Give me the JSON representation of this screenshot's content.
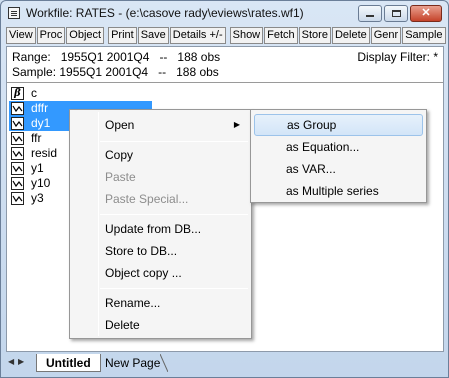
{
  "window": {
    "title": "Workfile: RATES - (e:\\casove rady\\eviews\\rates.wf1)",
    "controls": {
      "close_label": "✕"
    }
  },
  "toolbar": {
    "buttons": [
      "View",
      "Proc",
      "Object",
      "Print",
      "Save",
      "Details +/-",
      "Show",
      "Fetch",
      "Store",
      "Delete",
      "Genr",
      "Sample"
    ]
  },
  "info": {
    "range_line": "Range:   1955Q1 2001Q4   --   188 obs",
    "sample_line": "Sample: 1955Q1 2001Q4   --   188 obs",
    "display_filter": "Display Filter: *"
  },
  "objects": [
    {
      "name": "c",
      "icon": "coef-beta-icon",
      "glyph": "β",
      "selected": false
    },
    {
      "name": "dffr",
      "icon": "series-icon",
      "selected": true
    },
    {
      "name": "dy1",
      "icon": "series-icon",
      "selected": true
    },
    {
      "name": "ffr",
      "icon": "series-icon",
      "selected": false
    },
    {
      "name": "resid",
      "icon": "series-icon",
      "selected": false
    },
    {
      "name": "y1",
      "icon": "series-icon",
      "selected": false
    },
    {
      "name": "y10",
      "icon": "series-icon",
      "selected": false
    },
    {
      "name": "y3",
      "icon": "series-icon",
      "selected": false
    }
  ],
  "context_menu": {
    "items": [
      {
        "label": "Open",
        "has_submenu": true,
        "highlighted": false,
        "disabled": false
      },
      {
        "label": "Copy",
        "disabled": false
      },
      {
        "label": "Paste",
        "disabled": true
      },
      {
        "label": "Paste Special...",
        "disabled": true
      },
      {
        "label": "Update from DB...",
        "disabled": false
      },
      {
        "label": "Store to DB...",
        "disabled": false
      },
      {
        "label": "Object copy ...",
        "disabled": false
      },
      {
        "label": "Rename...",
        "disabled": false
      },
      {
        "label": "Delete",
        "disabled": false
      }
    ]
  },
  "submenu": {
    "items": [
      {
        "label": "as Group",
        "highlighted": true
      },
      {
        "label": "as Equation...",
        "highlighted": false
      },
      {
        "label": "as VAR...",
        "highlighted": false
      },
      {
        "label": "as Multiple series",
        "highlighted": false
      }
    ]
  },
  "tabs": {
    "items": [
      "Untitled",
      "New Page"
    ],
    "active": "Untitled"
  },
  "colors": {
    "selection": "#3399ff",
    "menu_highlight": "#d3e5f8",
    "close_button": "#c5432a"
  }
}
